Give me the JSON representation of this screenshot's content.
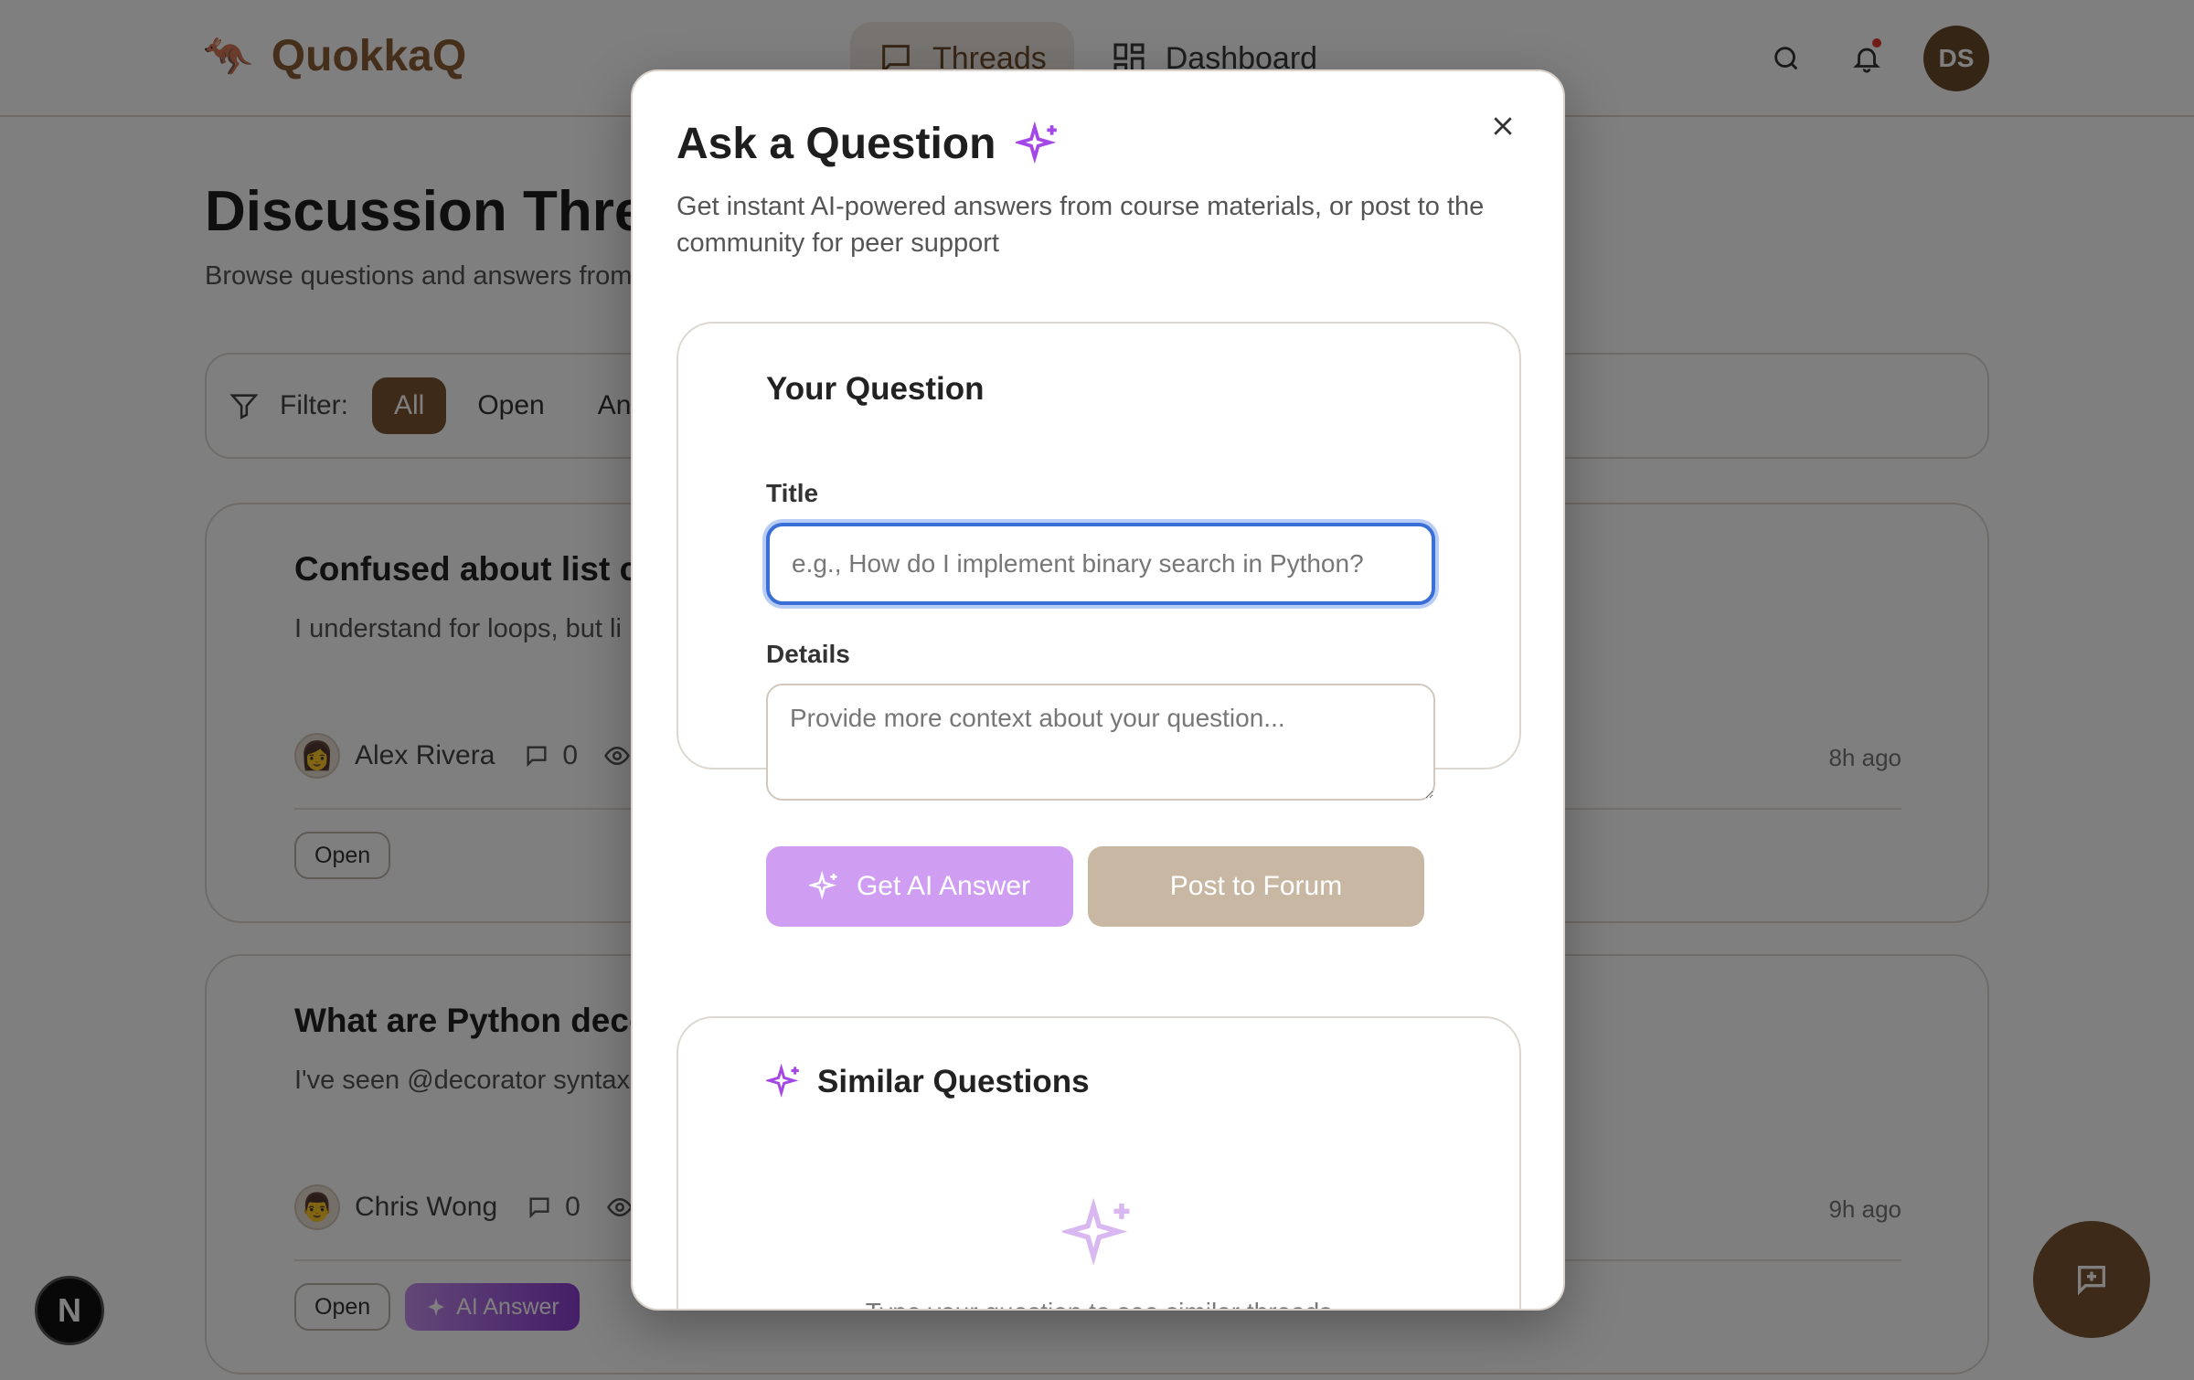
{
  "brand": {
    "name": "QuokkaQ",
    "logo_icon": "kangaroo-logo-icon"
  },
  "nav": {
    "items": [
      {
        "label": "Threads",
        "icon": "chat-bubble-icon",
        "active": true
      },
      {
        "label": "Dashboard",
        "icon": "grid-icon",
        "active": false
      }
    ]
  },
  "header_actions": {
    "avatar_initials": "DS",
    "has_notification": true
  },
  "page": {
    "title": "Discussion Threads",
    "subtitle": "Browse questions and answers from"
  },
  "filters": {
    "label": "Filter:",
    "options": [
      "All",
      "Open",
      "An"
    ],
    "active": "All"
  },
  "threads": [
    {
      "title": "Confused about list co",
      "excerpt": "I understand for loops, but li",
      "author": "Alex Rivera",
      "replies": "0",
      "time": "8h ago",
      "status": "Open",
      "ai_answer": null
    },
    {
      "title": "What are Python deco",
      "excerpt": "I've seen @decorator syntax",
      "author": "Chris Wong",
      "replies": "0",
      "time": "9h ago",
      "status": "Open",
      "ai_answer": "AI Answer"
    }
  ],
  "modal": {
    "title": "Ask a Question",
    "description": "Get instant AI-powered answers from course materials, or post to the community for peer support",
    "question_panel": {
      "heading": "Your Question",
      "title_label": "Title",
      "title_placeholder": "e.g., How do I implement binary search in Python?",
      "title_value": "",
      "details_label": "Details",
      "details_placeholder": "Provide more context about your question...",
      "details_value": "",
      "ai_button": "Get AI Answer",
      "post_button": "Post to Forum"
    },
    "similar_panel": {
      "heading": "Similar Questions",
      "empty_hint": "Type your question to see similar threads"
    }
  },
  "colors": {
    "brand_brown": "#7a5430",
    "ai_purple": "#cf9df2",
    "post_tan": "#c8b8a3",
    "focus_blue": "#3b6fd8",
    "notification_red": "#e53935"
  },
  "floating": {
    "next_badge": "N"
  }
}
